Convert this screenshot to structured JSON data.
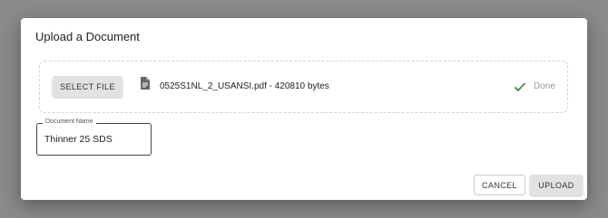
{
  "dialog": {
    "title": "Upload a Document",
    "dropzone": {
      "select_label": "SELECT FILE",
      "file_info": "0525S1NL_2_USANSI.pdf - 420810 bytes",
      "status": "Done"
    },
    "document_name": {
      "label": "Document Name",
      "value": "Thinner 25 SDS"
    },
    "actions": {
      "cancel_label": "CANCEL",
      "upload_label": "UPLOAD"
    }
  },
  "icons": {
    "file": "file-icon",
    "status": "check-icon"
  },
  "colors": {
    "backdrop": "#8a8a8a",
    "success": "#2e7d32",
    "muted": "#999999"
  }
}
